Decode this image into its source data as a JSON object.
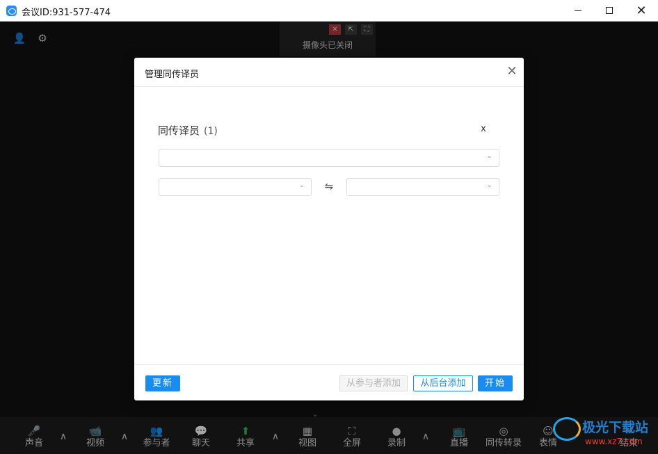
{
  "window": {
    "title": "会议ID:931-577-474",
    "min_glyph": "—",
    "max_glyph": "☐",
    "close_glyph": "✕"
  },
  "meeting": {
    "camera_off_text": "摄像头已关闭",
    "tile_cam_glyph": "✕",
    "tile_pop_glyph": "⇱",
    "tile_full_glyph": "⛶",
    "adduser_glyph": "👤",
    "gear_glyph": "⚙",
    "collapse_glyph": "⌄"
  },
  "dialog": {
    "title": "管理同传译员",
    "close_glyph": "✕",
    "section_title": "同传译员",
    "section_count": "(1)",
    "remove_glyph": "x",
    "select_chevron": "⌄",
    "swap_glyph": "⇋",
    "buttons": {
      "update": "更新",
      "from_participants": "从参与者添加",
      "from_backend": "从后台添加",
      "start": "开始"
    }
  },
  "toolbar": {
    "caret_glyph": "∧",
    "items": [
      {
        "label": "声音",
        "glyph": "🎤"
      },
      {
        "label": "视频",
        "glyph": "📹"
      },
      {
        "label": "参与者",
        "glyph": "👥"
      },
      {
        "label": "聊天",
        "glyph": "💬"
      },
      {
        "label": "共享",
        "glyph": "⬆"
      },
      {
        "label": "视图",
        "glyph": "▦"
      },
      {
        "label": "全屏",
        "glyph": "⛶"
      },
      {
        "label": "录制",
        "glyph": "●"
      },
      {
        "label": "直播",
        "glyph": "📺"
      },
      {
        "label": "同传转录",
        "glyph": "◎"
      },
      {
        "label": "表情",
        "glyph": "☺"
      },
      {
        "label": "结束",
        "glyph": "✕"
      }
    ]
  },
  "watermark": {
    "brand": "极光下载站",
    "url": "www.xz7.com"
  },
  "colors": {
    "accent": "#1a8cf0",
    "meeting_bg": "#111111",
    "camera_off_badge": "#b43a3a"
  }
}
